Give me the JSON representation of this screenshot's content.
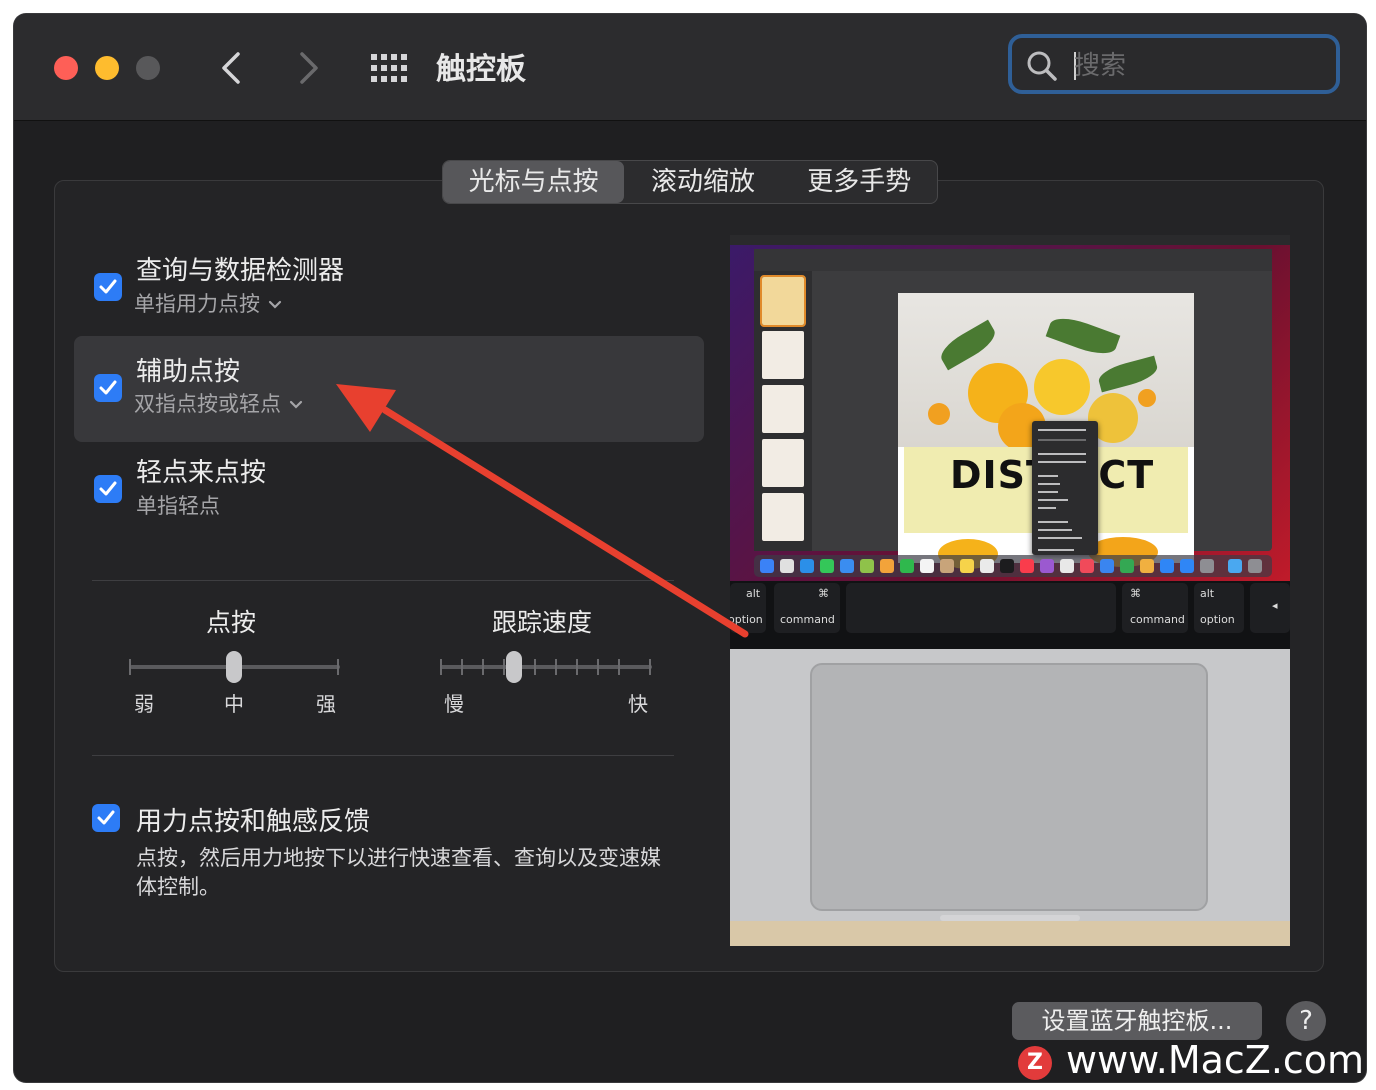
{
  "window": {
    "title": "触控板"
  },
  "search": {
    "placeholder": "搜索"
  },
  "tabs": [
    {
      "label": "光标与点按",
      "active": true
    },
    {
      "label": "滚动缩放",
      "active": false
    },
    {
      "label": "更多手势",
      "active": false
    }
  ],
  "options": [
    {
      "title": "查询与数据检测器",
      "subtitle": "单指用力点按",
      "checked": true,
      "has_dropdown": true
    },
    {
      "title": "辅助点按",
      "subtitle": "双指点按或轻点",
      "checked": true,
      "has_dropdown": true,
      "highlighted": true
    },
    {
      "title": "轻点来点按",
      "subtitle": "单指轻点",
      "checked": true,
      "has_dropdown": false
    }
  ],
  "sliders": {
    "click": {
      "label": "点按",
      "min_label": "弱",
      "mid_label": "中",
      "max_label": "强",
      "value": 0.5
    },
    "tracking": {
      "label": "跟踪速度",
      "min_label": "慢",
      "max_label": "快",
      "value": 0.33
    }
  },
  "force_click": {
    "title": "用力点按和触感反馈",
    "checked": true,
    "description": "点按，然后用力地按下以进行快速查看、查询以及变速媒体控制。"
  },
  "preview": {
    "headline": "DISTRICT",
    "keys": {
      "left_alt": "alt",
      "left_option": "option",
      "left_command": "command",
      "cmd_symbol": "⌘",
      "right_command": "command",
      "right_alt": "alt",
      "right_option": "option"
    }
  },
  "buttons": {
    "bluetooth": "设置蓝牙触控板...",
    "help": "?"
  },
  "watermark": {
    "logo": "Z",
    "text": "www.MacZ.com"
  },
  "colors": {
    "accent": "#2d7cf6",
    "focus_ring": "#2f5f97",
    "annotation_arrow": "#e8402f"
  }
}
